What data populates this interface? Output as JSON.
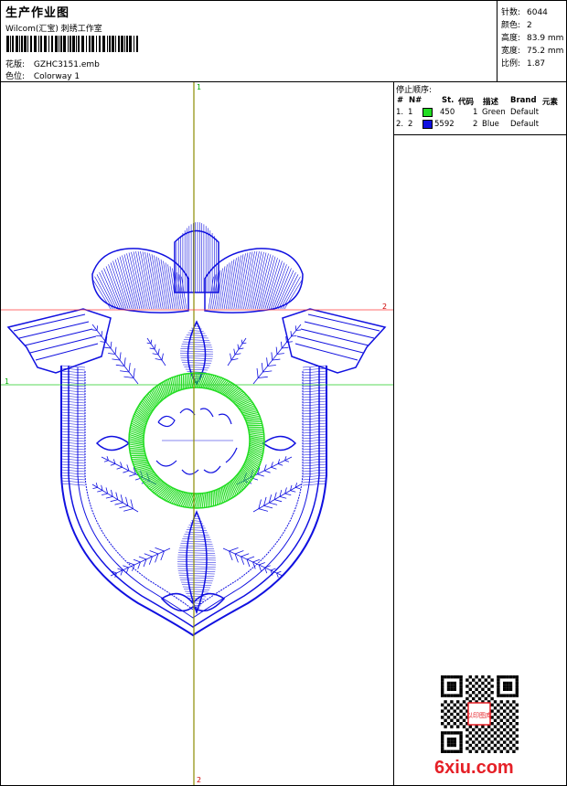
{
  "header": {
    "title": "生产作业图",
    "company": "Wilcom(汇宝) 刺绣工作室",
    "design_label": "花版:",
    "design_value": "GZHC3151.emb",
    "colorway_label": "色位:",
    "colorway_value": "Colorway 1"
  },
  "stats": [
    {
      "label": "针数:",
      "value": "6044"
    },
    {
      "label": "颜色:",
      "value": "2"
    },
    {
      "label": "高度:",
      "value": "83.9 mm"
    },
    {
      "label": "宽度:",
      "value": "75.2 mm"
    },
    {
      "label": "比例:",
      "value": "1.87"
    }
  ],
  "stop_sequence": {
    "title": "停止顺序:",
    "columns": {
      "num": "#",
      "needle": "N#",
      "stitches": "St.",
      "code": "代码",
      "desc": "描述",
      "brand": "Brand",
      "element": "元素"
    },
    "rows": [
      {
        "num": "1.",
        "needle": "1",
        "color": "#22dd22",
        "stitches": "450",
        "code": "1",
        "desc": "Green",
        "brand": "Default"
      },
      {
        "num": "2.",
        "needle": "2",
        "color": "#1010e0",
        "stitches": "5592",
        "code": "2",
        "desc": "Blue",
        "brand": "Default"
      }
    ]
  },
  "guides": {
    "vertical_top": "1",
    "vertical_bottom": "2",
    "horizontal_red": "2",
    "horizontal_green": "1",
    "vertical_color": "#8b8b00",
    "red_color": "#ff3b3b",
    "green_color": "#22cc22"
  },
  "watermark": {
    "site": "6xiu.com",
    "seal": "以印图库"
  }
}
